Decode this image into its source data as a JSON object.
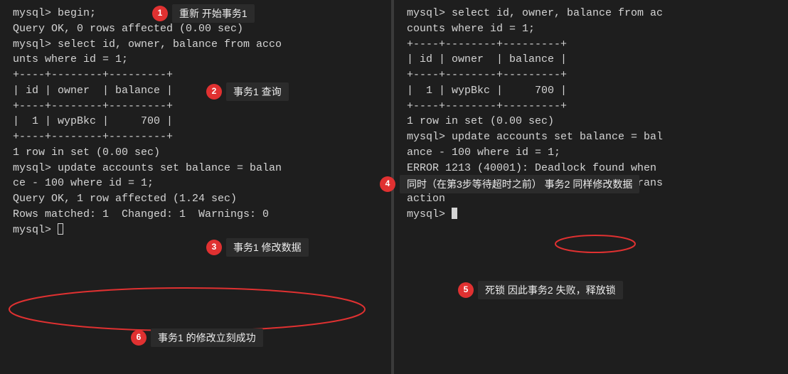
{
  "left": {
    "l1": "mysql> begin;",
    "l2": "Query OK, 0 rows affected (0.00 sec)",
    "l3": "",
    "l4": "mysql> select id, owner, balance from acco",
    "l5": "unts where id = 1;",
    "l6": "+----+--------+---------+",
    "l7": "| id | owner  | balance |",
    "l8": "+----+--------+---------+",
    "l9": "|  1 | wypBkc |     700 |",
    "l10": "+----+--------+---------+",
    "l11": "1 row in set (0.00 sec)",
    "l12": "",
    "l13": "mysql> update accounts set balance = balan",
    "l14": "ce - 100 where id = 1;",
    "l15": "Query OK, 1 row affected (1.24 sec)",
    "l16": "Rows matched: 1  Changed: 1  Warnings: 0",
    "l17": "",
    "l18": "mysql> "
  },
  "right": {
    "l1": "mysql> select id, owner, balance from ac",
    "l2": "counts where id = 1;",
    "l3": "+----+--------+---------+",
    "l4": "| id | owner  | balance |",
    "l5": "+----+--------+---------+",
    "l6": "|  1 | wypBkc |     700 |",
    "l7": "+----+--------+---------+",
    "l8": "1 row in set (0.00 sec)",
    "l9": "",
    "l10": "mysql> update accounts set balance = bal",
    "l11": "ance - 100 where id = 1;",
    "l12": "ERROR 1213 (40001): Deadlock found when ",
    "l13": "trying to get lock; try restarting trans",
    "l14": "action",
    "l15": "mysql> "
  },
  "annotations": {
    "a1": {
      "num": "1",
      "label": "重新 开始事务1"
    },
    "a2": {
      "num": "2",
      "label": "事务1 查询"
    },
    "a3": {
      "num": "3",
      "label": "事务1 修改数据"
    },
    "a4": {
      "num": "4",
      "label": "同时（在第3步等待超时之前） 事务2 同样修改数据"
    },
    "a5": {
      "num": "5",
      "label": "死锁 因此事务2 失败，释放锁"
    },
    "a6": {
      "num": "6",
      "label": "事务1 的修改立刻成功"
    }
  },
  "chart_data": {
    "type": "table",
    "columns": [
      "id",
      "owner",
      "balance"
    ],
    "rows": [
      {
        "id": 1,
        "owner": "wypBkc",
        "balance": 700
      }
    ]
  }
}
